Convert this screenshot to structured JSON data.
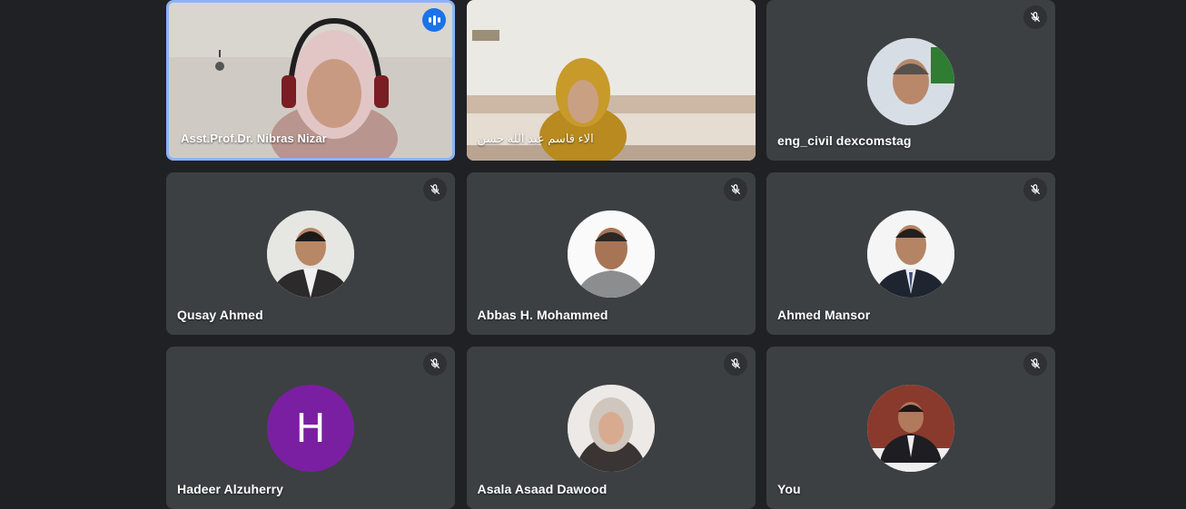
{
  "participants": [
    {
      "name": "Asst.Prof.Dr. Nibras Nizar",
      "state": "speaking",
      "view": "video",
      "icon": "audio-level-icon"
    },
    {
      "name": "الاء قاسم عبد الله حسن",
      "state": "active",
      "view": "video",
      "icon": ""
    },
    {
      "name": "eng_civil dexcomstag",
      "state": "muted",
      "view": "photo",
      "icon": "mic-off-icon"
    },
    {
      "name": "Qusay Ahmed",
      "state": "muted",
      "view": "photo",
      "icon": "mic-off-icon"
    },
    {
      "name": "Abbas H. Mohammed",
      "state": "muted",
      "view": "photo",
      "icon": "mic-off-icon"
    },
    {
      "name": "Ahmed Mansor",
      "state": "muted",
      "view": "photo",
      "icon": "mic-off-icon"
    },
    {
      "name": "Hadeer Alzuherry",
      "state": "muted",
      "view": "initial",
      "initial": "H",
      "icon": "mic-off-icon"
    },
    {
      "name": "Asala Asaad Dawood",
      "state": "muted",
      "view": "photo",
      "icon": "mic-off-icon"
    },
    {
      "name": "You",
      "state": "muted",
      "view": "photo",
      "icon": "mic-off-icon"
    }
  ],
  "colors": {
    "background": "#202124",
    "tile": "#3c4043",
    "speaking_border": "#8ab4f8",
    "audio_indicator": "#1a73e8",
    "initial_avatar": "#7b1fa2"
  }
}
